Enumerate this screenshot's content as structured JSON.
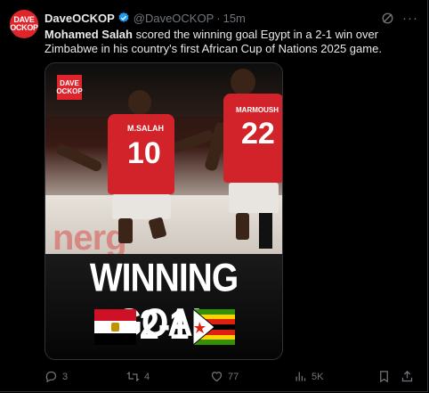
{
  "post": {
    "author_name": "DaveOCKOP",
    "handle": "@DaveOCKOP",
    "separator": "·",
    "time": "15m",
    "text_bold": "Mohamed Salah",
    "text_rest": " scored the winning goal Egypt in a 2-1 win over Zimbabwe in his country's first African Cup of Nations 2025 game.",
    "avatar_line1": "DAVE",
    "avatar_line2": "OCKOP"
  },
  "media": {
    "badge_line1": "DAVE",
    "badge_line2": "OCKOP",
    "player1_name": "M.SALAH",
    "player1_number": "10",
    "player2_name": "MARMOUSH",
    "player2_number": "22",
    "board_text": "nerg",
    "headline": "WINNING GOAL",
    "score": "2-1"
  },
  "actions": {
    "replies": "3",
    "reposts": "4",
    "likes": "77",
    "views": "5K"
  },
  "colors": {
    "background": "#000000",
    "text": "#e7e9ea",
    "muted": "#71767b",
    "verified": "#1d9bf0",
    "brand_red": "#e0242b"
  },
  "icons": [
    "verified-badge-icon",
    "grok-icon",
    "more-icon",
    "reply-icon",
    "repost-icon",
    "like-icon",
    "views-icon",
    "bookmark-icon",
    "share-icon"
  ]
}
